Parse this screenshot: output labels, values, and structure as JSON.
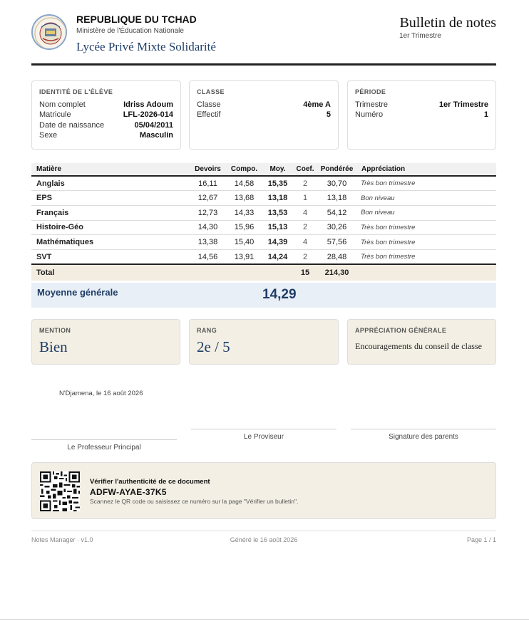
{
  "header": {
    "country": "REPUBLIQUE DU TCHAD",
    "ministry": "Ministère de l'Éducation Nationale",
    "school": "Lycée Privé Mixte Solidarité",
    "title": "Bulletin de notes",
    "subtitle": "1er Trimestre"
  },
  "student_box": {
    "title": "IDENTITÉ DE L'ÉLÈVE",
    "rows": [
      {
        "label": "Nom complet",
        "value": "Idriss Adoum"
      },
      {
        "label": "Matricule",
        "value": "LFL-2026-014"
      },
      {
        "label": "Date de naissance",
        "value": "05/04/2011"
      },
      {
        "label": "Sexe",
        "value": "Masculin"
      }
    ]
  },
  "class_box": {
    "title": "CLASSE",
    "rows": [
      {
        "label": "Classe",
        "value": "4ème A"
      },
      {
        "label": "Effectif",
        "value": "5"
      }
    ]
  },
  "period_box": {
    "title": "PÉRIODE",
    "rows": [
      {
        "label": "Trimestre",
        "value": "1er Trimestre"
      },
      {
        "label": "Numéro",
        "value": "1"
      }
    ]
  },
  "table": {
    "headers": [
      "Matière",
      "Devoirs",
      "Compo.",
      "Moy.",
      "Coef.",
      "Pondérée",
      "Appréciation"
    ],
    "rows": [
      {
        "subject": "Anglais",
        "devoirs": "16,11",
        "compo": "14,58",
        "moy": "15,35",
        "coef": "2",
        "ponderee": "30,70",
        "appreciation": "Très bon trimestre"
      },
      {
        "subject": "EPS",
        "devoirs": "12,67",
        "compo": "13,68",
        "moy": "13,18",
        "coef": "1",
        "ponderee": "13,18",
        "appreciation": "Bon niveau"
      },
      {
        "subject": "Français",
        "devoirs": "12,73",
        "compo": "14,33",
        "moy": "13,53",
        "coef": "4",
        "ponderee": "54,12",
        "appreciation": "Bon niveau"
      },
      {
        "subject": "Histoire-Géo",
        "devoirs": "14,30",
        "compo": "15,96",
        "moy": "15,13",
        "coef": "2",
        "ponderee": "30,26",
        "appreciation": "Très bon trimestre"
      },
      {
        "subject": "Mathématiques",
        "devoirs": "13,38",
        "compo": "15,40",
        "moy": "14,39",
        "coef": "4",
        "ponderee": "57,56",
        "appreciation": "Très bon trimestre"
      },
      {
        "subject": "SVT",
        "devoirs": "14,56",
        "compo": "13,91",
        "moy": "14,24",
        "coef": "2",
        "ponderee": "28,48",
        "appreciation": "Très bon trimestre"
      }
    ],
    "total": {
      "label": "Total",
      "coef": "15",
      "ponderee": "214,30"
    }
  },
  "average": {
    "label": "Moyenne générale",
    "value": "14,29"
  },
  "summary": {
    "mention_title": "MENTION",
    "mention_value": "Bien",
    "rang_title": "RANG",
    "rang_value": "2e / 5",
    "appreciation_title": "APPRÉCIATION GÉNÉRALE",
    "appreciation_value": "Encouragements du conseil de classe"
  },
  "place_date": "N'Djamena, le 16 août 2026",
  "signatures": {
    "prof": "Le Professeur Principal",
    "proviseur": "Le Proviseur",
    "parents": "Signature des parents"
  },
  "verification": {
    "title": "Vérifier l'authenticité de ce document",
    "code": "ADFW-AYAE-37K5",
    "note": "Scannez le QR code ou saisissez ce numéro sur la page \"Vérifier un bulletin\"."
  },
  "footer": {
    "app": "Notes Manager · v1.0",
    "generated": "Généré le 16 août 2026",
    "page": "Page 1 / 1"
  }
}
